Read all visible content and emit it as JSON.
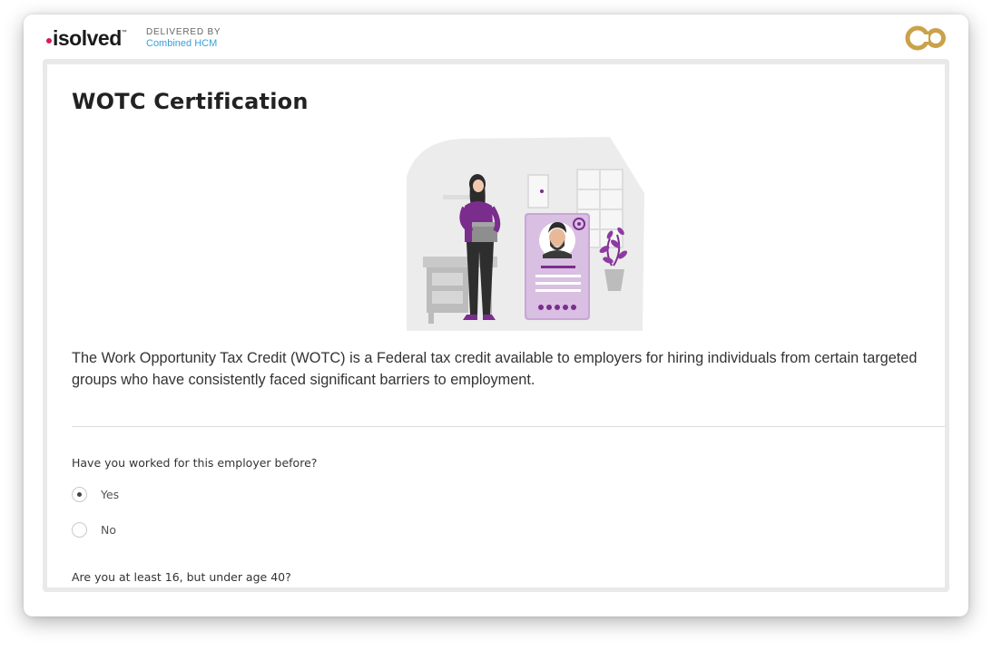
{
  "header": {
    "logo_text": "isolved",
    "logo_trademark": "™",
    "delivered_by_label": "DELIVERED BY",
    "delivered_by_company": "Combined HCM",
    "partner_logo_text": "CO",
    "colors": {
      "logo_dot": "#d81b60",
      "company_link": "#3aa0d8",
      "partner_gold": "#c9a24a"
    }
  },
  "page": {
    "title": "WOTC Certification",
    "description": "The Work Opportunity Tax Credit (WOTC) is a Federal tax credit available to employers for hiring individuals from certain targeted groups who have consistently faced significant barriers to employment.",
    "illustration_icon": "employee-id-card-illustration",
    "illustration_colors": {
      "purple": "#7b2d8e",
      "lavender": "#c9a6d6",
      "gray": "#ececec"
    }
  },
  "questions": [
    {
      "label": "Have you worked for this employer before?",
      "options": [
        {
          "label": "Yes",
          "selected": true
        },
        {
          "label": "No",
          "selected": false
        }
      ]
    },
    {
      "label": "Are you at least 16, but under age 40?"
    }
  ]
}
